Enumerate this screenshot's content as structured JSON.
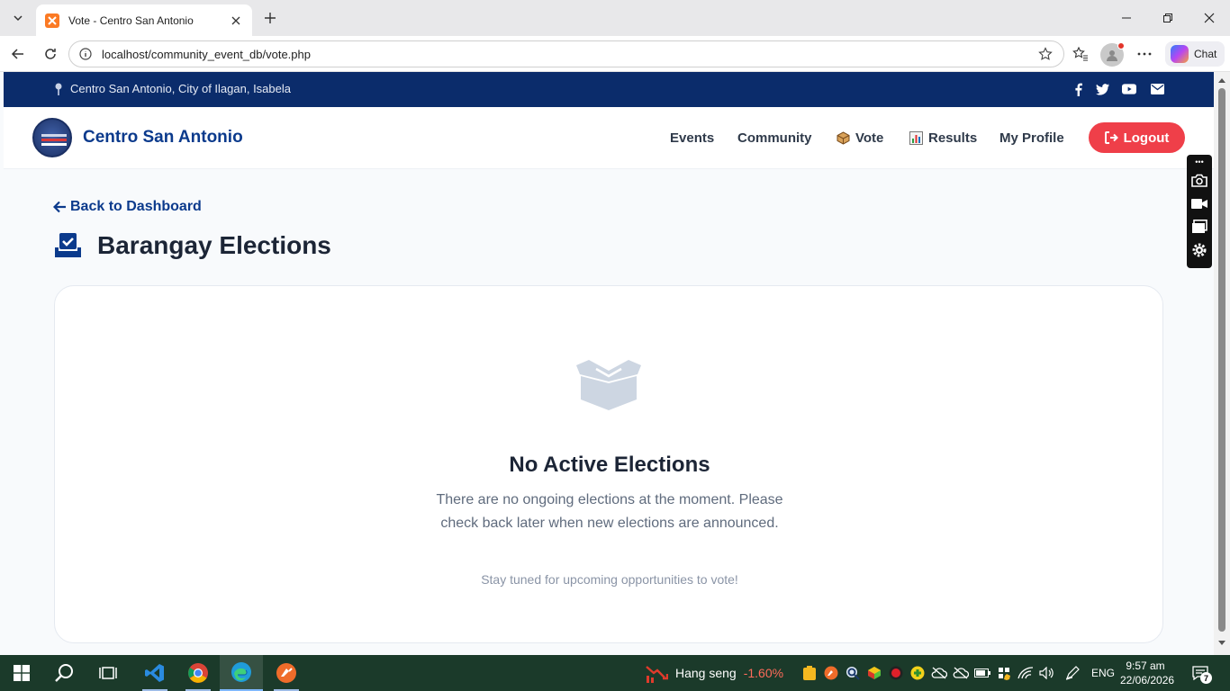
{
  "browser": {
    "tab_title": "Vote - Centro San Antonio",
    "url": "localhost/community_event_db/vote.php",
    "chat_label": "Chat"
  },
  "topbar": {
    "location": "Centro San Antonio, City of Ilagan, Isabela",
    "social_icons": [
      "facebook-icon",
      "twitter-icon",
      "youtube-icon",
      "envelope-icon"
    ]
  },
  "navbar": {
    "brand": "Centro San Antonio",
    "items": [
      {
        "label": "Events"
      },
      {
        "label": "Community"
      },
      {
        "label": "Vote",
        "icon": "ballot-box-icon"
      },
      {
        "label": "Results",
        "icon": "bar-chart-icon"
      },
      {
        "label": "My Profile"
      }
    ],
    "logout": "Logout"
  },
  "main": {
    "back_link": "Back to Dashboard",
    "title": "Barangay Elections",
    "empty_state": {
      "icon": "open-box-icon",
      "title": "No Active Elections",
      "description": "There are no ongoing elections at the moment. Please check back later when new elections are announced.",
      "tip": "Stay tuned for upcoming opportunities to vote!"
    }
  },
  "taskbar": {
    "stock_name": "Hang seng",
    "stock_change": "-1.60%",
    "language": "ENG",
    "time": "9:57 am",
    "date": "22/06/2026",
    "notification_count": "7"
  },
  "colors": {
    "topbar_bg": "#0b2c6b",
    "brand_blue": "#0b3a8c",
    "logout_red": "#ef3f49",
    "taskbar_bg": "#1b3a2a"
  }
}
